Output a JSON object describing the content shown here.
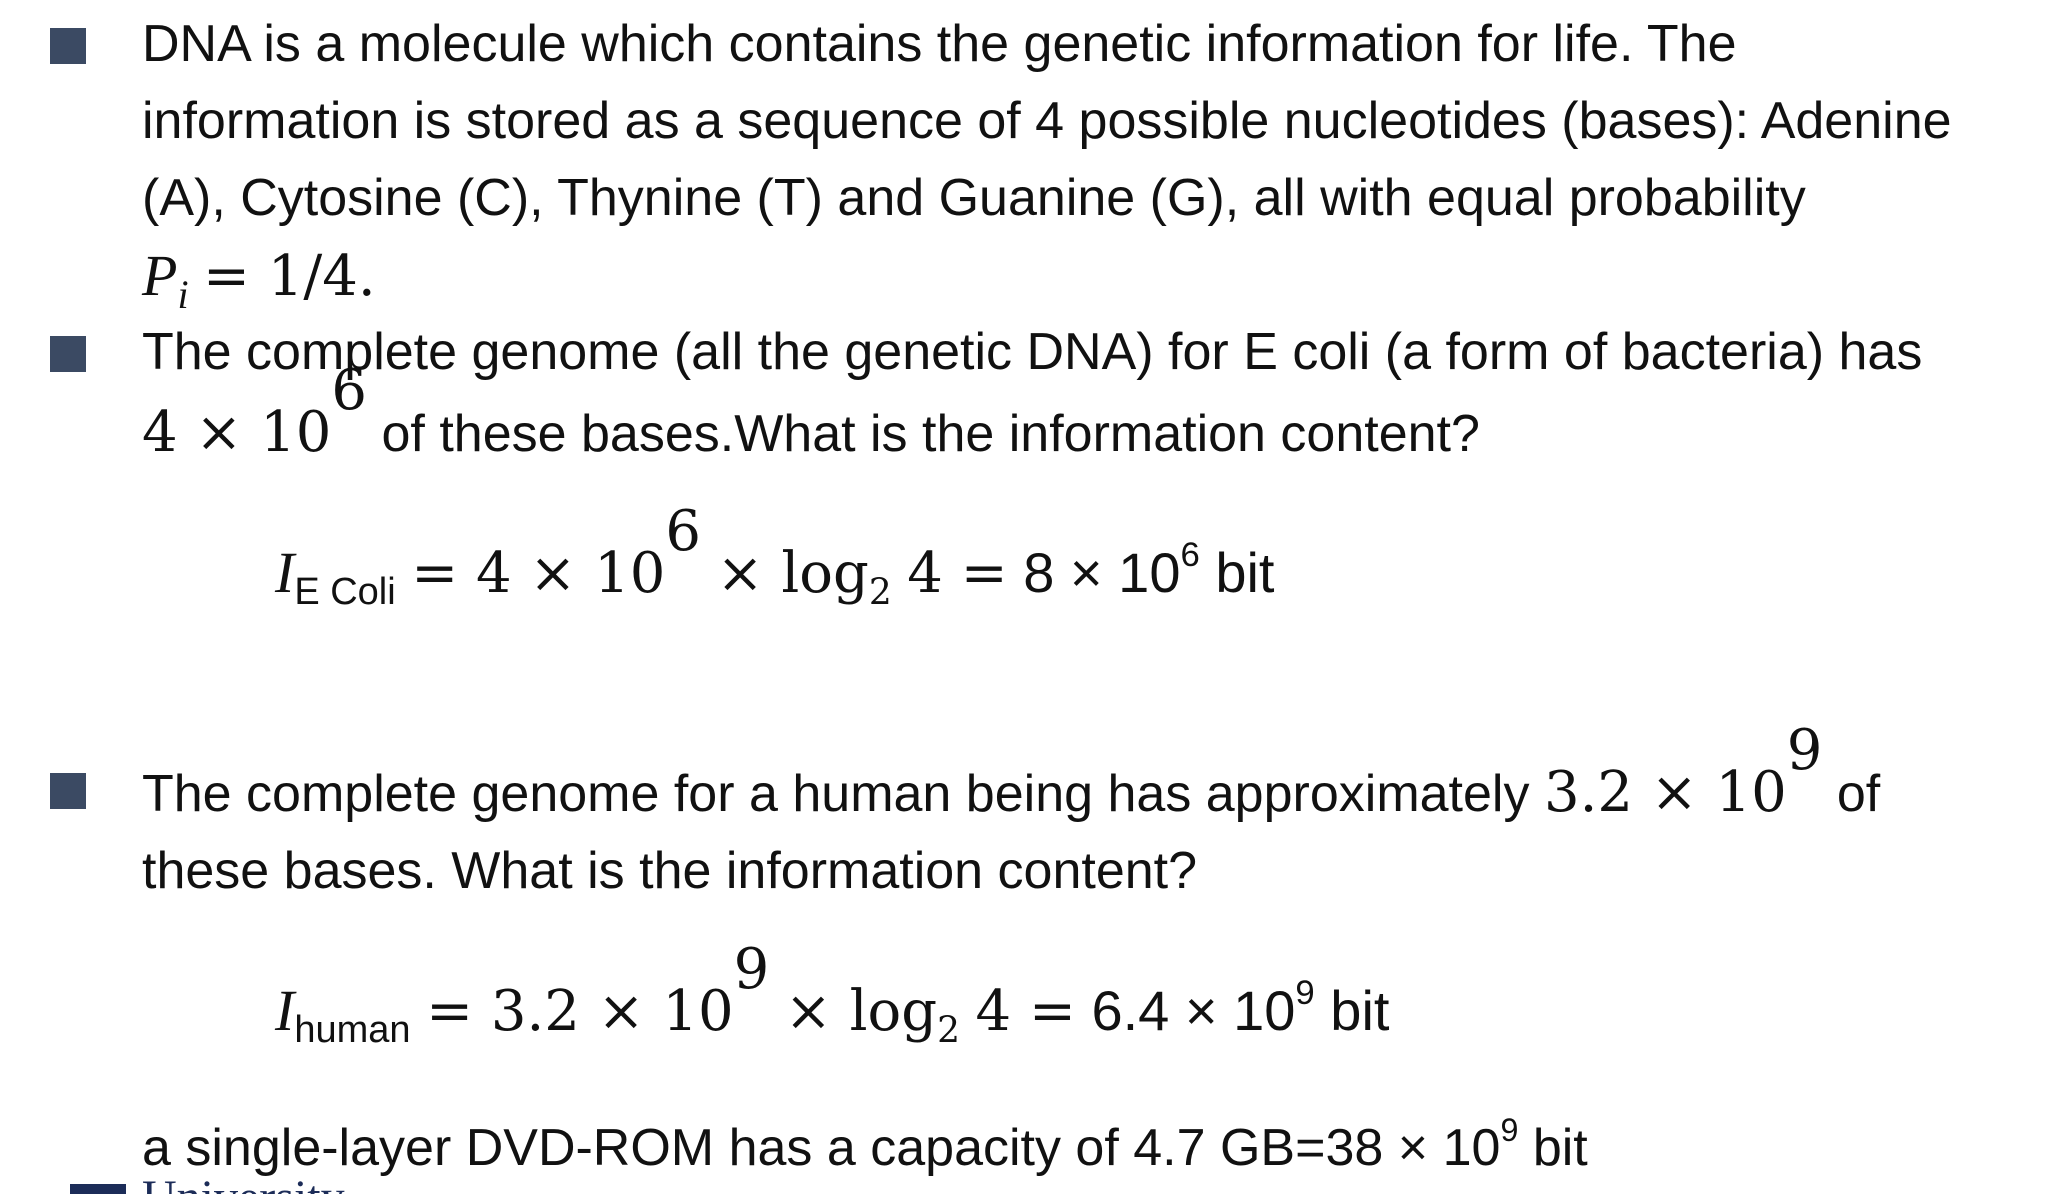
{
  "bullets": [
    {
      "lines": [
        "DNA is a molecule which contains the genetic information for life. The",
        "information is stored as a sequence of 4 possible nucleotides (bases): Adenine",
        "(A), Cytosine (C), Thynine (T) and Guanine (G), all with equal probability"
      ],
      "formula": {
        "var": "P",
        "sub": "i",
        "rhs": "= 1/4."
      }
    },
    {
      "line1": "The complete genome (all the genetic DNA) for E coli (a form of bacteria) has",
      "line2_math": "4 × 10",
      "line2_exp": "6",
      "line2_text": "of these bases.What is the information content?"
    },
    {
      "line1_text": "The complete genome for a human being has approximately",
      "line1_math": "3.2 × 10",
      "line1_exp": "9",
      "line1_tail": "of",
      "line2": "these bases. What is the information content?"
    }
  ],
  "eq_ecoli": {
    "var": "I",
    "sub": "E Coli",
    "p1": "= 4 × 10",
    "e1": "6",
    "p2": "× log",
    "log_base": "2",
    "p3": "4 =",
    "p4": "8 × 10",
    "e2": "6",
    "unit": "bit"
  },
  "eq_human": {
    "var": "I",
    "sub": "human",
    "p1": "= 3.2 × 10",
    "e1": "9",
    "p2": "× log",
    "log_base": "2",
    "p3": "4 =",
    "p4": "6.4 × 10",
    "e2": "9",
    "unit": "bit"
  },
  "dvd": {
    "text": "a single-layer DVD-ROM has a capacity of 4.7 GB=38 × 10",
    "exp": "9",
    "unit": "bit"
  },
  "footer_logo_text": "University"
}
